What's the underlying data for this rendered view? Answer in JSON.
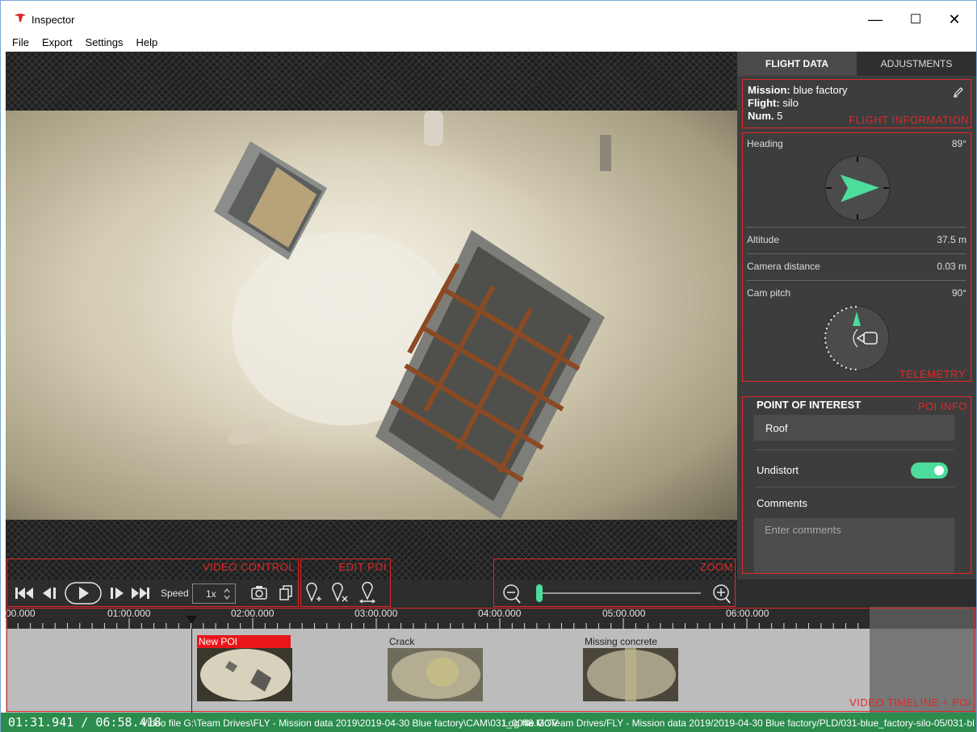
{
  "app": {
    "title": "Inspector"
  },
  "window_controls": {
    "minimize": "—",
    "maximize": "☐",
    "close": "✕"
  },
  "menu": [
    "File",
    "Export",
    "Settings",
    "Help"
  ],
  "tabs": [
    {
      "label": "FLIGHT DATA"
    },
    {
      "label": "ADJUSTMENTS"
    }
  ],
  "flight_info": {
    "mission_label": "Mission:",
    "mission": "blue factory",
    "flight_label": "Flight:",
    "flight": "silo",
    "num_label": "Num.",
    "num": "5",
    "section_label": "FLIGHT INFORMATION"
  },
  "telemetry": {
    "heading_label": "Heading",
    "heading": "89°",
    "heading_deg": 89,
    "altitude_label": "Altitude",
    "altitude": "37.5 m",
    "camera_distance_label": "Camera distance",
    "camera_distance": "0.03 m",
    "cam_pitch_label": "Cam pitch",
    "cam_pitch": "90°",
    "section_label": "TELEMETRY"
  },
  "poi_info": {
    "title": "POINT OF INTEREST",
    "section_label": "POI INFO",
    "name_value": "Roof",
    "undistort_label": "Undistort",
    "undistort_on": true,
    "comments_label": "Comments",
    "comments_placeholder": "Enter comments"
  },
  "controls": {
    "video_control_label": "VIDEO CONTROL",
    "edit_poi_label": "EDIT POI",
    "zoom_label": "ZOOM",
    "speed_label": "Speed",
    "speed_value": "1x",
    "zoom_level": 0
  },
  "timeline": {
    "ticks": [
      "00.000",
      "01:00.000",
      "02:00.000",
      "03:00.000",
      "04:00.000",
      "05:00.000",
      "06:00.000"
    ],
    "section_label": "VIDEO TIMELINE + POI",
    "pois": [
      {
        "name": "New POI"
      },
      {
        "name": "Crack"
      },
      {
        "name": "Missing concrete"
      }
    ]
  },
  "status": {
    "timecode": "01:31.941 / 06:58.418",
    "video_file": "Video file  G:\\Team Drives\\FLY - Mission data 2019\\2019-04-30 Blue factory\\CAM\\031_0048.MOV",
    "log_file": "Log file G:\\Team Drives/FLY - Mission data 2019/2019-04-30 Blue factory/PLD/031-blue_factory-silo-05/031-bl"
  },
  "colors": {
    "accent": "#4cdc9b",
    "annotation": "#e02828",
    "status_bar": "#2c8c4e",
    "poi_new": "#e8161b"
  }
}
